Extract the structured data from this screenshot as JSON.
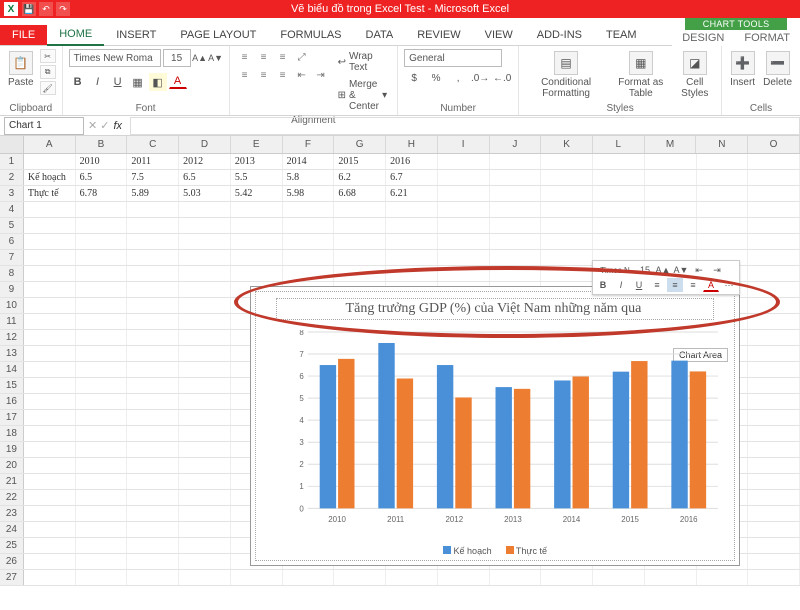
{
  "app": {
    "title": "Vẽ biểu đồ trong Excel Test - Microsoft Excel",
    "chart_tools": "CHART TOOLS"
  },
  "tabs": {
    "file": "FILE",
    "home": "HOME",
    "insert": "INSERT",
    "pagelayout": "PAGE LAYOUT",
    "formulas": "FORMULAS",
    "data": "DATA",
    "review": "REVIEW",
    "view": "VIEW",
    "addins": "ADD-INS",
    "team": "TEAM",
    "design": "DESIGN",
    "format": "FORMAT"
  },
  "ribbon": {
    "clipboard": "Clipboard",
    "font": "Font",
    "alignment": "Alignment",
    "number": "Number",
    "styles": "Styles",
    "cells": "Cells",
    "paste": "Paste",
    "fontname": "Times New Roma",
    "fontsize": "15",
    "wrap": "Wrap Text",
    "merge": "Merge & Center",
    "numfmt": "General",
    "cond": "Conditional Formatting",
    "fmtTable": "Format as Table",
    "cellstyles": "Cell Styles",
    "insert": "Insert",
    "delete": "Delete"
  },
  "fx": {
    "name": "Chart 1",
    "fx": "fx"
  },
  "columns": [
    "A",
    "B",
    "C",
    "D",
    "E",
    "F",
    "G",
    "H",
    "I",
    "J",
    "K",
    "L",
    "M",
    "N",
    "O"
  ],
  "sheet": {
    "r1": {
      "B": "2010",
      "C": "2011",
      "D": "2012",
      "E": "2013",
      "F": "2014",
      "G": "2015",
      "H": "2016"
    },
    "r2": {
      "A": "Kế hoạch",
      "B": "6.5",
      "C": "7.5",
      "D": "6.5",
      "E": "5.5",
      "F": "5.8",
      "G": "6.2",
      "H": "6.7"
    },
    "r3": {
      "A": "Thực tế",
      "B": "6.78",
      "C": "5.89",
      "D": "5.03",
      "E": "5.42",
      "F": "5.98",
      "G": "6.68",
      "H": "6.21"
    }
  },
  "chart_data": {
    "type": "bar",
    "title": "Tăng trưởng GDP (%) của Việt Nam những năm qua",
    "categories": [
      "2010",
      "2011",
      "2012",
      "2013",
      "2014",
      "2015",
      "2016"
    ],
    "series": [
      {
        "name": "Kế hoạch",
        "values": [
          6.5,
          7.5,
          6.5,
          5.5,
          5.8,
          6.2,
          6.7
        ]
      },
      {
        "name": "Thực tế",
        "values": [
          6.78,
          5.89,
          5.03,
          5.42,
          5.98,
          6.68,
          6.21
        ]
      }
    ],
    "ylim": [
      0,
      8
    ],
    "yticks": [
      0,
      1,
      2,
      3,
      4,
      5,
      6,
      7,
      8
    ],
    "tooltip": "Chart Area"
  }
}
